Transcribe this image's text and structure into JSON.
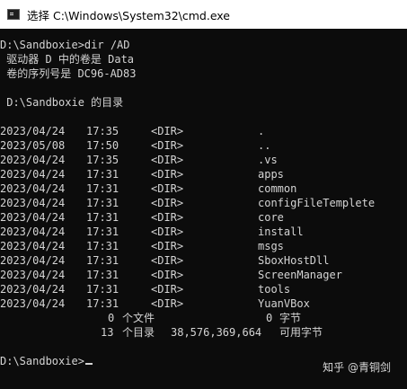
{
  "window": {
    "title": "选择 C:\\Windows\\System32\\cmd.exe",
    "icon": "cmd-console-icon"
  },
  "console": {
    "command_line": "D:\\Sandboxie>dir /AD",
    "volume_line": " 驱动器 D 中的卷是 Data",
    "serial_line": " 卷的序列号是 DC96-AD83",
    "dir_header": " D:\\Sandboxie 的目录",
    "entries": [
      {
        "date": "2023/04/24",
        "time": "17:35",
        "type": "<DIR>",
        "name": "."
      },
      {
        "date": "2023/05/08",
        "time": "17:50",
        "type": "<DIR>",
        "name": ".."
      },
      {
        "date": "2023/04/24",
        "time": "17:35",
        "type": "<DIR>",
        "name": ".vs"
      },
      {
        "date": "2023/04/24",
        "time": "17:31",
        "type": "<DIR>",
        "name": "apps"
      },
      {
        "date": "2023/04/24",
        "time": "17:31",
        "type": "<DIR>",
        "name": "common"
      },
      {
        "date": "2023/04/24",
        "time": "17:31",
        "type": "<DIR>",
        "name": "configFileTemplete"
      },
      {
        "date": "2023/04/24",
        "time": "17:31",
        "type": "<DIR>",
        "name": "core"
      },
      {
        "date": "2023/04/24",
        "time": "17:31",
        "type": "<DIR>",
        "name": "install"
      },
      {
        "date": "2023/04/24",
        "time": "17:31",
        "type": "<DIR>",
        "name": "msgs"
      },
      {
        "date": "2023/04/24",
        "time": "17:31",
        "type": "<DIR>",
        "name": "SboxHostDll"
      },
      {
        "date": "2023/04/24",
        "time": "17:31",
        "type": "<DIR>",
        "name": "ScreenManager"
      },
      {
        "date": "2023/04/24",
        "time": "17:31",
        "type": "<DIR>",
        "name": "tools"
      },
      {
        "date": "2023/04/24",
        "time": "17:31",
        "type": "<DIR>",
        "name": "YuanVBox"
      }
    ],
    "summary_files_count": "0",
    "summary_files_label": "个文件",
    "summary_files_bytes": "0",
    "summary_files_bytes_label": "字节",
    "summary_dirs_count": "13",
    "summary_dirs_label": "个目录",
    "summary_dirs_free": "38,576,369,664",
    "summary_dirs_free_label": "可用字节",
    "prompt": "D:\\Sandboxie>"
  },
  "watermark": "知乎 @青铜剑",
  "colors": {
    "background": "#0c0c0c",
    "text": "#d4d4d4",
    "titlebar": "#ffffff"
  }
}
